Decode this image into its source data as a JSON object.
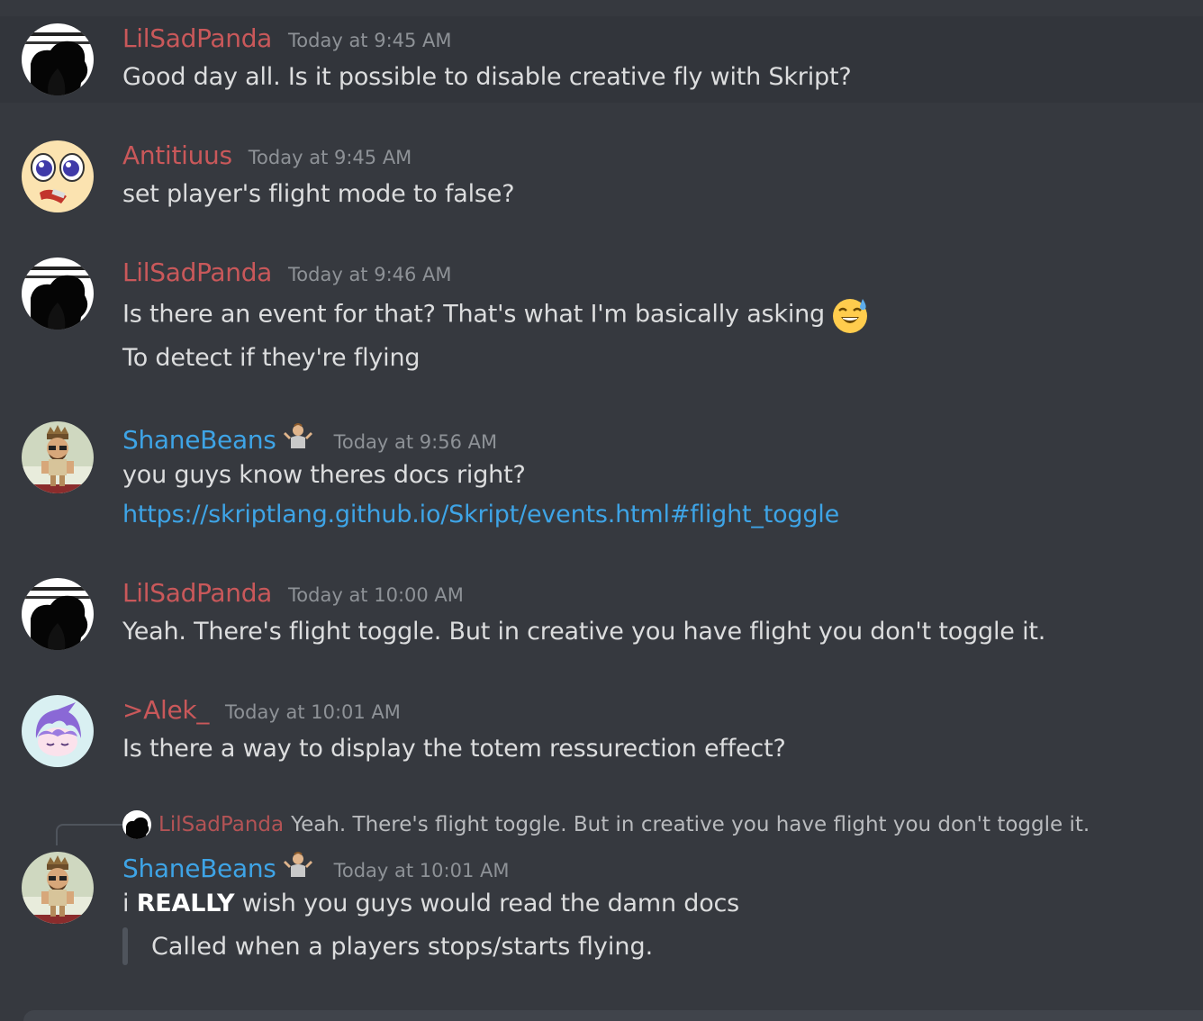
{
  "colors": {
    "background": "#36393f",
    "highlight_background": "#32353b",
    "username_red": "#c9585a",
    "username_blue": "#3ea4e6",
    "link": "#00b0f4",
    "timestamp": "#8e9297"
  },
  "messages": [
    {
      "username": "LilSadPanda",
      "timestamp": "Today at 9:45 AM",
      "lines": [
        "Good day all. Is it possible to disable creative fly with Skript?"
      ]
    },
    {
      "username": "Antitiuus",
      "timestamp": "Today at 9:45 AM",
      "lines": [
        "set player's flight mode to false?"
      ]
    },
    {
      "username": "LilSadPanda",
      "timestamp": "Today at 9:46 AM",
      "lines": [
        "Is there an event for that? That's what I'm basically asking",
        "To detect if they're flying"
      ],
      "emoji": "sweat-smile-emoji"
    },
    {
      "username": "ShaneBeans",
      "timestamp": "Today at 9:56 AM",
      "badge": "shrug-emoji",
      "lines": [
        "you guys know theres docs right?"
      ],
      "link": "https://skriptlang.github.io/Skript/events.html#flight_toggle"
    },
    {
      "username": "LilSadPanda",
      "timestamp": "Today at 10:00 AM",
      "lines": [
        "Yeah. There's flight toggle. But in creative you have flight you don't toggle it."
      ]
    },
    {
      "username": ">Alek_",
      "timestamp": "Today at 10:01 AM",
      "lines": [
        "Is there a way to display the totem ressurection effect?"
      ]
    },
    {
      "username": "ShaneBeans",
      "timestamp": "Today at 10:01 AM",
      "badge": "shrug-emoji",
      "reply_to": {
        "username": "LilSadPanda",
        "text": "Yeah. There's flight toggle. But in creative you have flight you don't toggle it."
      },
      "text_before_bold": "i ",
      "bold": "REALLY",
      "text_after_bold": " wish you guys would read the damn docs",
      "quote": "Called when a players stops/starts flying."
    }
  ]
}
